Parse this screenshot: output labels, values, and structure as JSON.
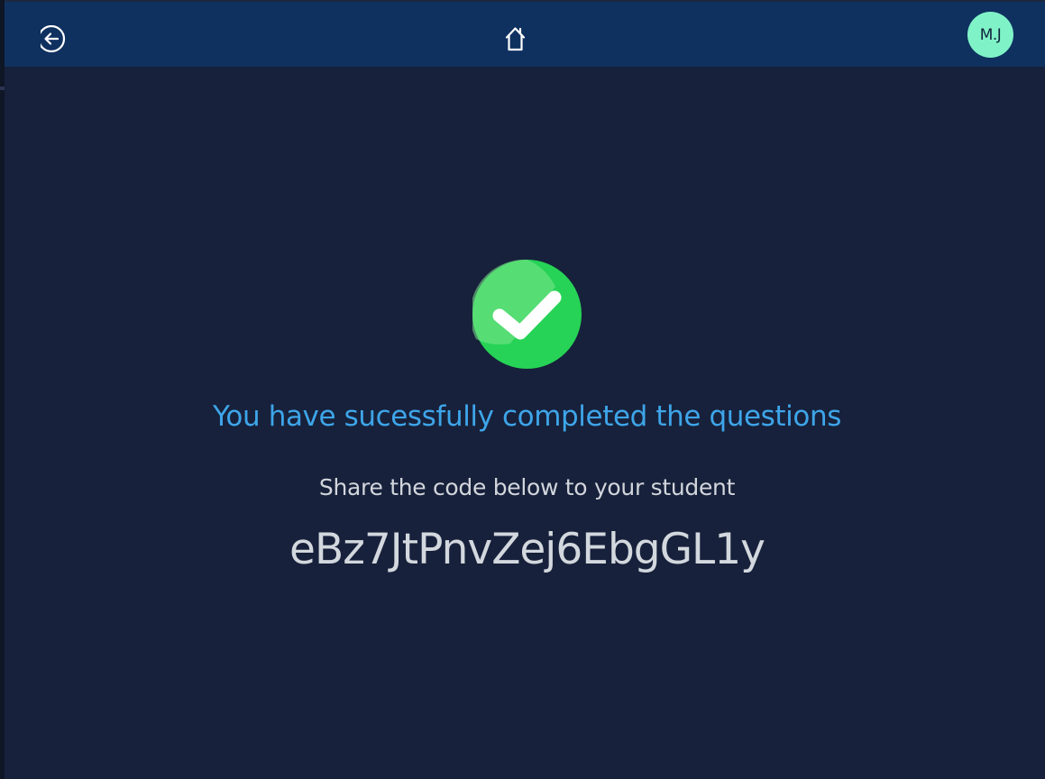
{
  "header": {
    "back_icon": "arrow-left-circle-icon",
    "home_icon": "home-icon",
    "avatar_initials": "M.J",
    "avatar_color": "#7ff3c7",
    "bar_color": "#0f3160"
  },
  "main": {
    "status_icon": "check-circle-icon",
    "status_color": "#26d356",
    "title": "You have sucessfully completed the questions",
    "title_color": "#3ea5e9",
    "share_label": "Share the code below to your student",
    "code": "eBz7JtPnvZej6EbgGL1y"
  },
  "colors": {
    "background": "#17213b",
    "text": "#d2d6dc"
  }
}
